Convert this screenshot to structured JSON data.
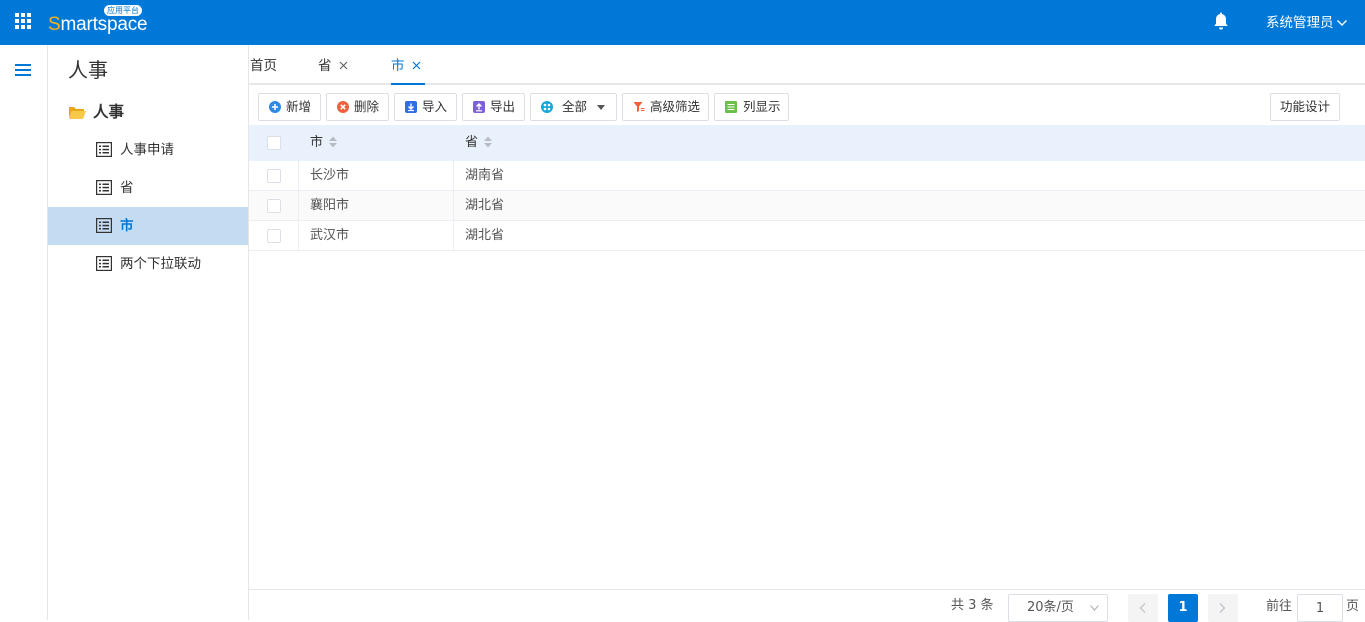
{
  "header": {
    "logo_first": "S",
    "logo_rest": "martspace",
    "logo_badge": "应用平台",
    "user": "系统管理员",
    "bg_color": "#0078d7"
  },
  "sidebar": {
    "title": "人事",
    "group": "人事",
    "items": [
      {
        "label": "人事申请",
        "active": false
      },
      {
        "label": "省",
        "active": false
      },
      {
        "label": "市",
        "active": true
      },
      {
        "label": "两个下拉联动",
        "active": false
      }
    ]
  },
  "tabs": [
    {
      "label": "首页",
      "closable": false,
      "active": false
    },
    {
      "label": "省",
      "closable": true,
      "active": false
    },
    {
      "label": "市",
      "closable": true,
      "active": true
    }
  ],
  "toolbar": {
    "add": "新增",
    "delete": "删除",
    "import": "导入",
    "export": "导出",
    "scope": "全部",
    "advanced_filter": "高级筛选",
    "columns": "列显示",
    "function_design": "功能设计"
  },
  "table": {
    "columns": [
      "市",
      "省"
    ],
    "rows": [
      [
        "长沙市",
        "湖南省"
      ],
      [
        "襄阳市",
        "湖北省"
      ],
      [
        "武汉市",
        "湖北省"
      ]
    ]
  },
  "pagination": {
    "total": "共 3 条",
    "page_size": "20条/页",
    "current_page": "1",
    "goto_label": "前往",
    "goto_value": "1",
    "page_suffix": "页"
  },
  "colors": {
    "accent": "#0078d7",
    "active_row": "#c4dcf2",
    "table_header": "#e9f2fc"
  }
}
